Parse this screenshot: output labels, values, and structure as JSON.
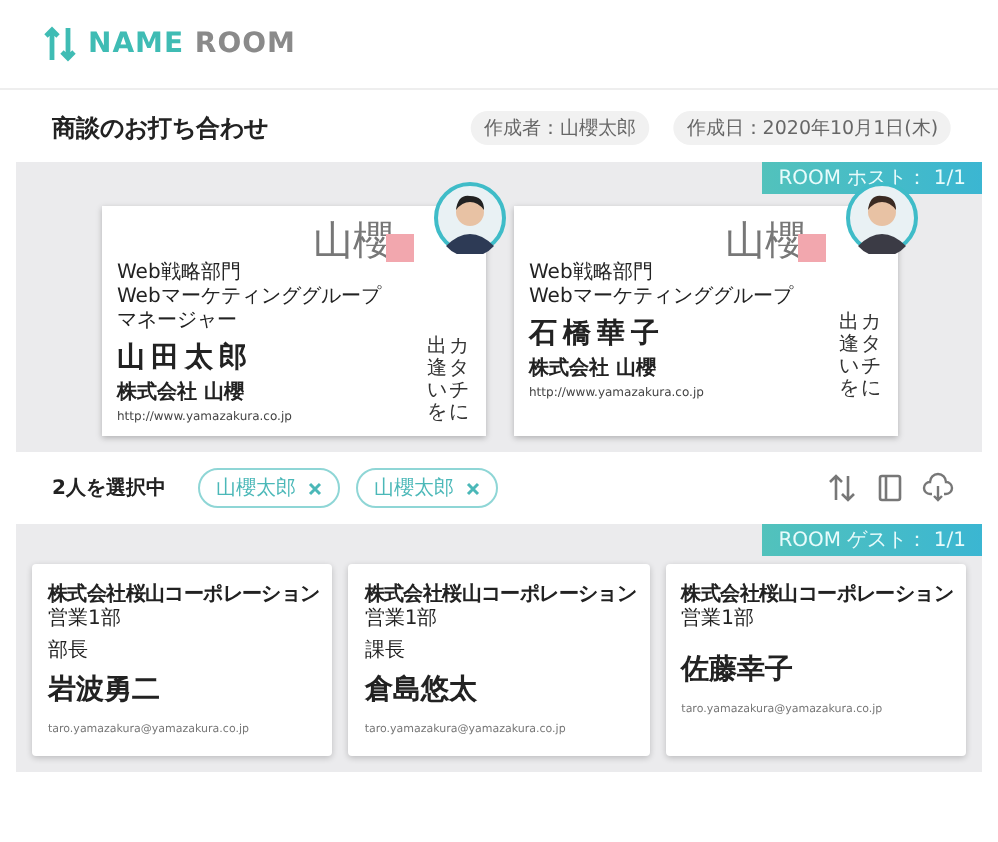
{
  "header": {
    "logo": {
      "word1": "NAME",
      "word2": "ROOM"
    }
  },
  "meeting": {
    "title": "商談のお打ち合わせ",
    "meta": [
      "作成者：山櫻太郎",
      "作成日：2020年10月1日(木)"
    ]
  },
  "host_room": {
    "badge": "ROOM ホスト： 1/1",
    "cards": [
      {
        "lines": [
          "Web戦略部門",
          "Webマーケティンググループ",
          "マネージャー"
        ],
        "name": "山田太郎",
        "company": "株式会社 山櫻",
        "url": "http://www.yamazakura.co.jp",
        "logo": "山櫻",
        "tagline": [
          "出逢いを",
          "カタチに"
        ]
      },
      {
        "lines": [
          "Web戦略部門",
          "Webマーケティンググループ"
        ],
        "name": "石橋華子",
        "company": "株式会社 山櫻",
        "url": "http://www.yamazakura.co.jp",
        "logo": "山櫻",
        "tagline": [
          "出逢いを",
          "カタチに"
        ]
      }
    ]
  },
  "selection": {
    "count": "2人を選択中",
    "chips": [
      "山櫻太郎",
      "山櫻太郎"
    ]
  },
  "guest_room": {
    "badge": "ROOM ゲスト： 1/1",
    "cards": [
      {
        "company": "株式会社桜山コーポレーション",
        "department": "営業1部",
        "title": "部長",
        "name": "岩波勇二",
        "email": "taro.yamazakura@yamazakura.co.jp"
      },
      {
        "company": "株式会社桜山コーポレーション",
        "department": "営業1部",
        "title": "課長",
        "name": "倉島悠太",
        "email": "taro.yamazakura@yamazakura.co.jp"
      },
      {
        "company": "株式会社桜山コーポレーション",
        "department": "営業1部",
        "name": "佐藤幸子",
        "email": "taro.yamazakura@yamazakura.co.jp"
      }
    ]
  }
}
